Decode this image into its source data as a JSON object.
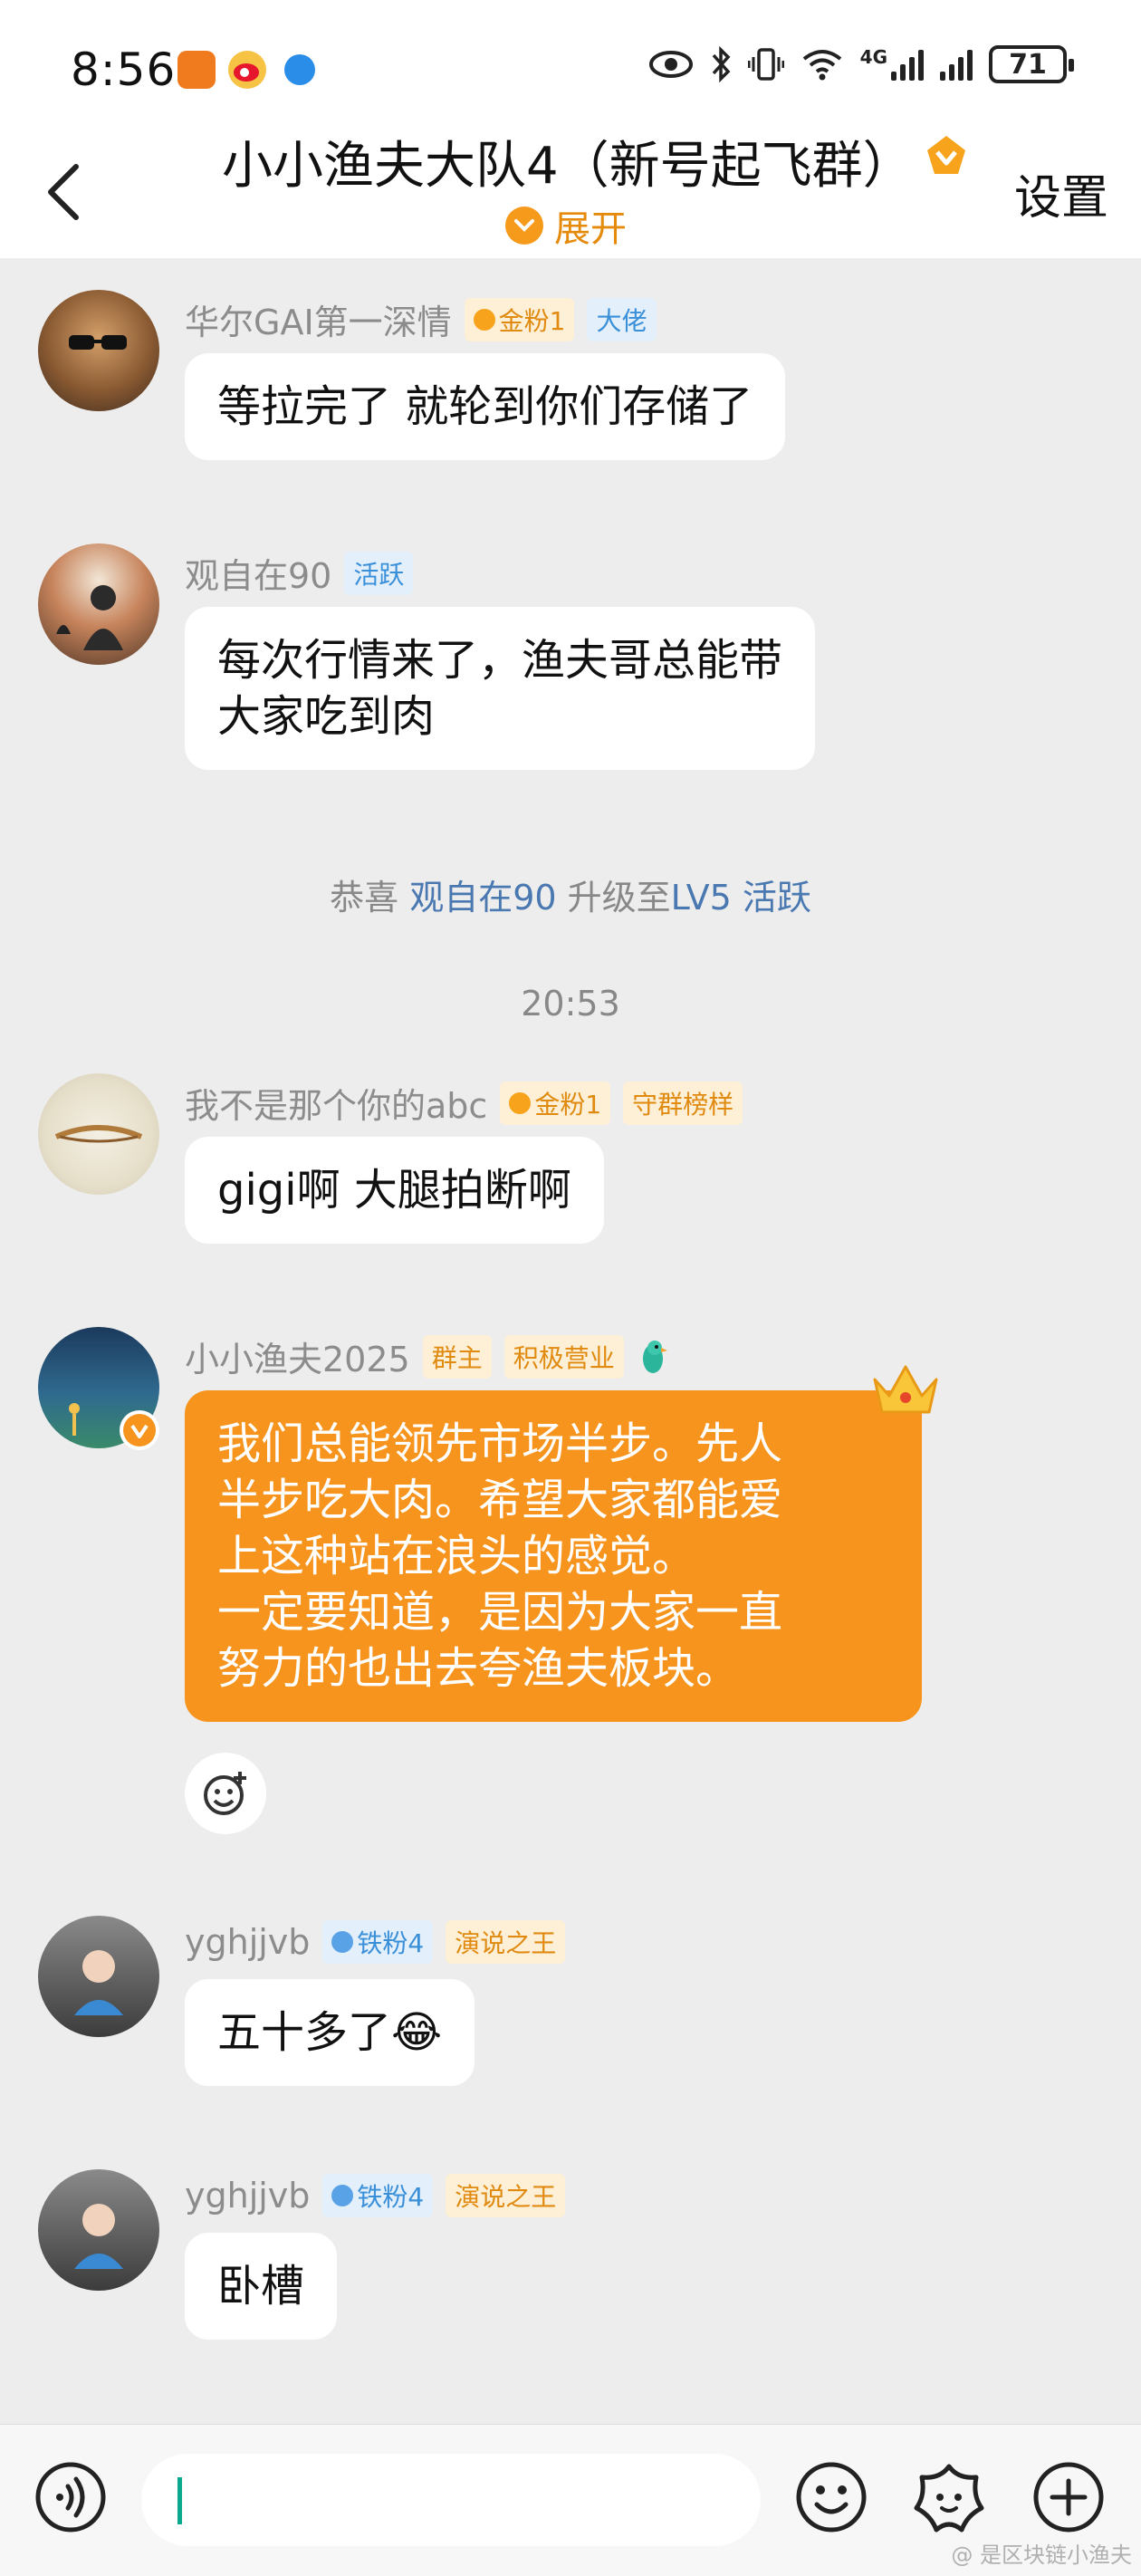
{
  "status": {
    "time": "8:56",
    "network": "4G",
    "battery": "71"
  },
  "header": {
    "title": "小小渔夫大队4（新号起飞群）",
    "expand_label": "展开",
    "settings_label": "设置"
  },
  "messages": [
    {
      "sender": "华尔GAI第一深情",
      "badges": [
        "金粉1",
        "大佬"
      ],
      "text": "等拉完了 就轮到你们存储了"
    },
    {
      "sender": "观自在90",
      "badges": [
        "活跃"
      ],
      "text": "每次行情来了，渔夫哥总能带\n大家吃到肉"
    },
    {
      "sender": "我不是那个你的abc",
      "badges": [
        "金粉1",
        "守群榜样"
      ],
      "text": "gigi啊 大腿拍断啊"
    },
    {
      "sender": "小小渔夫2025",
      "badges": [
        "群主",
        "积极营业"
      ],
      "text": "我们总能领先市场半步。先人\n半步吃大肉。希望大家都能爱\n上这种站在浪头的感觉。\n一定要知道，是因为大家一直\n努力的也出去夸渔夫板块。"
    },
    {
      "sender": "yghjjvb",
      "badges": [
        "铁粉4",
        "演说之王"
      ],
      "text": "五十多了😂"
    },
    {
      "sender": "yghjjvb",
      "badges": [
        "铁粉4",
        "演说之王"
      ],
      "text": "卧槽"
    }
  ],
  "system_notice": {
    "prefix": "恭喜",
    "user": "观自在90",
    "middle": "升级至",
    "level": "LV5 活跃"
  },
  "timestamp": "20:53",
  "watermark": "@ 是区块链小渔夫"
}
